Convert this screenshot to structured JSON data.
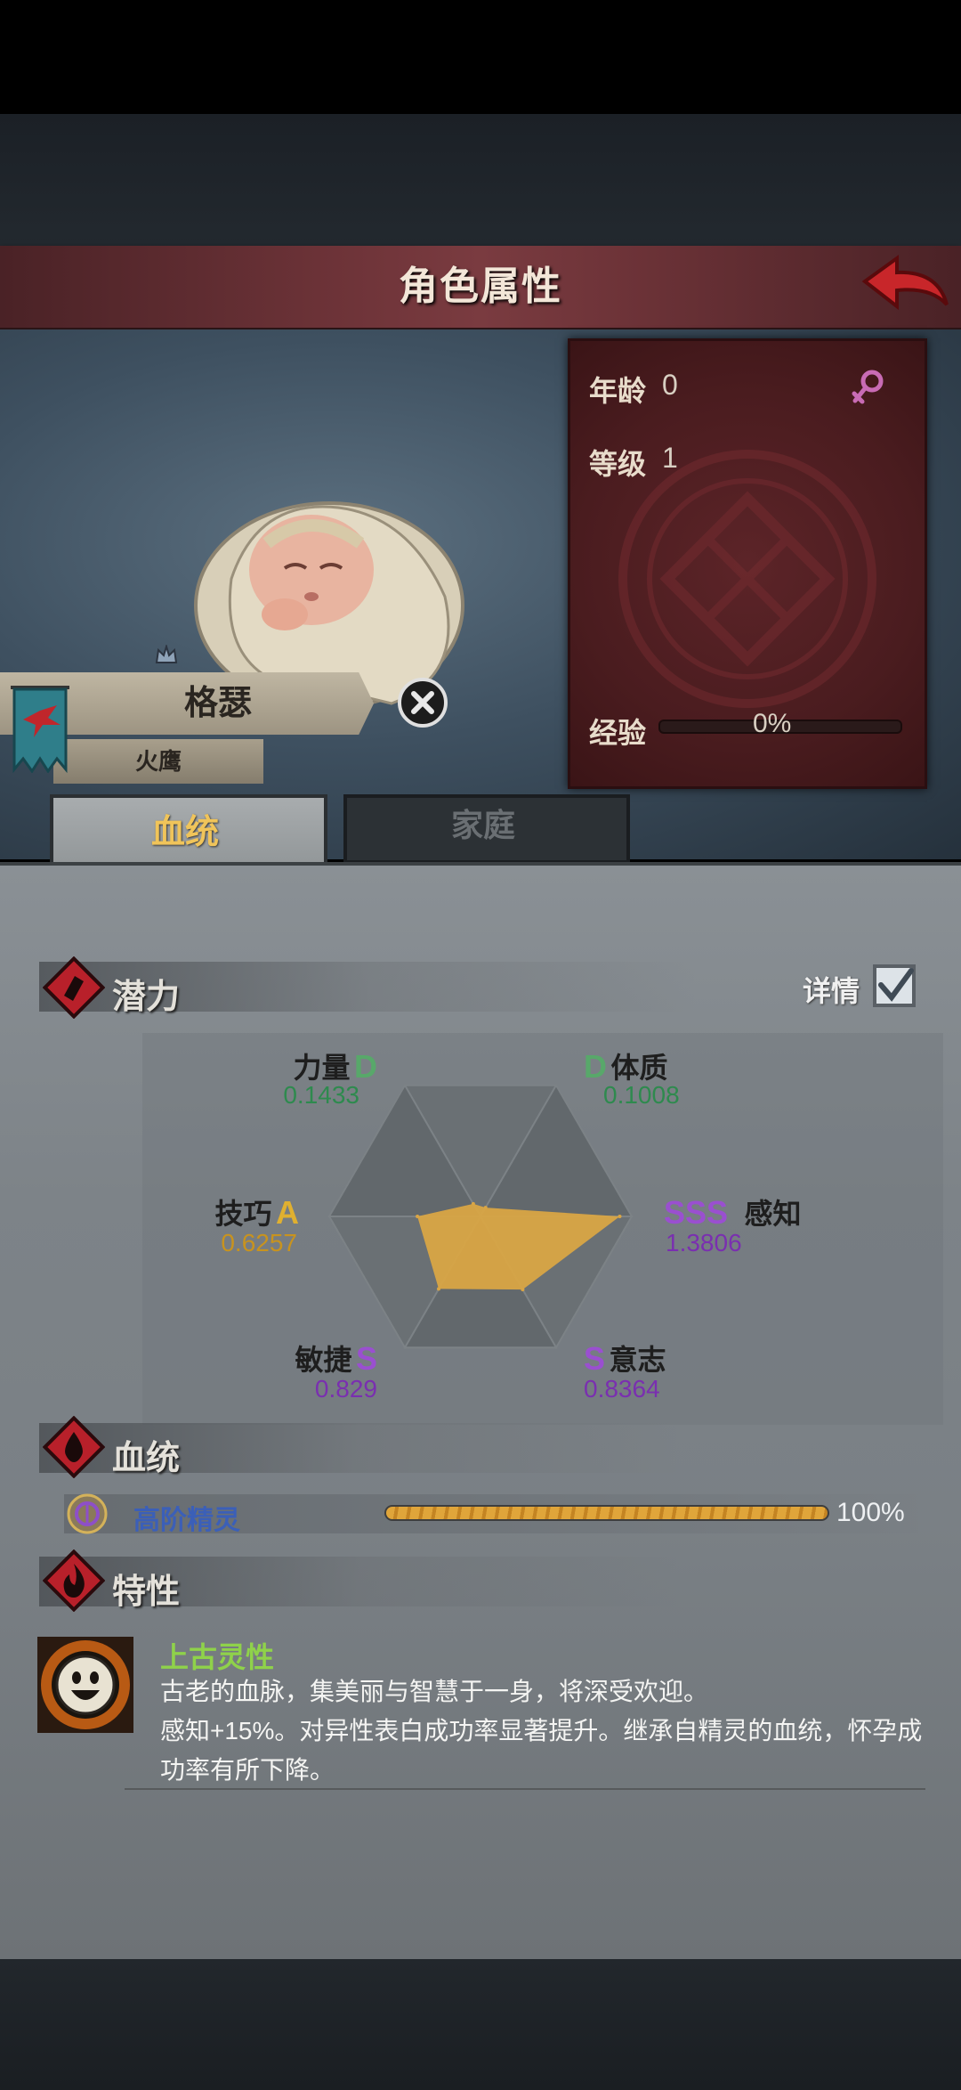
{
  "header": {
    "title": "角色属性"
  },
  "character": {
    "name": "格瑟",
    "house": "火鹰",
    "age_label": "年龄",
    "age_value": "0",
    "level_label": "等级",
    "level_value": "1",
    "exp_label": "经验",
    "exp_value": "0%",
    "exp_fraction": 0
  },
  "tabs": [
    {
      "label": "血统",
      "active": true
    },
    {
      "label": "家庭",
      "active": false
    }
  ],
  "potential": {
    "title": "潜力",
    "details_label": "详情",
    "details_checked": true,
    "stats": [
      {
        "name": "力量",
        "grade": "D",
        "value": "0.1433",
        "color": "#58a86a"
      },
      {
        "name": "体质",
        "grade": "D",
        "value": "0.1008",
        "color": "#58a86a"
      },
      {
        "name": "感知",
        "grade": "SSS",
        "value": "1.3806",
        "color": "#9a4fd0"
      },
      {
        "name": "意志",
        "grade": "S",
        "value": "0.8364",
        "color": "#9a4fd0"
      },
      {
        "name": "敏捷",
        "grade": "S",
        "value": "0.829",
        "color": "#9a4fd0"
      },
      {
        "name": "技巧",
        "grade": "A",
        "value": "0.6257",
        "color": "#e0b030"
      }
    ]
  },
  "chart_data": {
    "type": "radar",
    "axes": [
      "力量",
      "体质",
      "感知",
      "意志",
      "敏捷",
      "技巧"
    ],
    "values": [
      0.1433,
      0.1008,
      1.3806,
      0.8364,
      0.829,
      0.6257
    ],
    "fill_color": "#d9a545"
  },
  "bloodline": {
    "title": "血统",
    "name": "高阶精灵",
    "percent_text": "100%",
    "fraction": 1.0
  },
  "traits": {
    "title": "特性",
    "items": [
      {
        "name": "上古灵性",
        "line1": "古老的血脉，集美丽与智慧于一身，将深受欢迎。",
        "line2": "感知+15%。对异性表白成功率显著提升。继承自精灵的血统，怀孕成",
        "line3": "功率有所下降。"
      }
    ]
  },
  "colors": {
    "accent_gold": "#f0c45a",
    "title_red": "#6d3338",
    "trait_green": "#8fd24a"
  }
}
